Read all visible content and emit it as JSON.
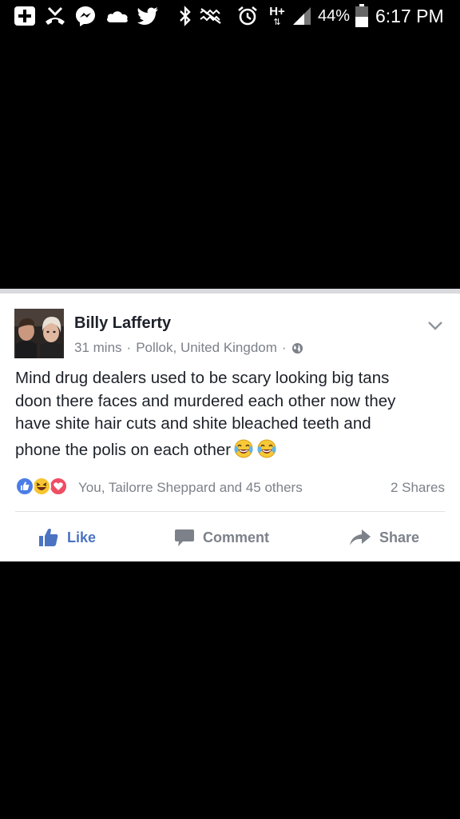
{
  "status_bar": {
    "battery_percent": "44%",
    "time": "6:17 PM",
    "network": "H+",
    "icons_left": [
      "add-square-icon",
      "missed-call-icon",
      "messenger-icon",
      "cloud-icon",
      "twitter-icon"
    ],
    "icons_right": [
      "bluetooth-icon",
      "nfc-icon",
      "alarm-icon",
      "network-icon",
      "signal-icon",
      "battery-icon"
    ]
  },
  "post": {
    "author": "Billy Lafferty",
    "time": "31 mins",
    "separator": "·",
    "location": "Pollok, United Kingdom",
    "privacy": "globe-icon",
    "body_lines": [
      "Mind drug dealers used to be scary looking big tans",
      "doon there faces and murdered each other now they",
      "have shite hair cuts and shite bleached teeth and",
      "phone the polis on each other"
    ],
    "body_emojis": [
      "crying-laughing-emoji",
      "crying-laughing-emoji"
    ],
    "reaction_icons": [
      "like-reaction-icon",
      "haha-reaction-icon",
      "love-reaction-icon"
    ],
    "reaction_summary": "You, Tailorre Sheppard and 45 others",
    "shares": "2 Shares",
    "actions": {
      "like": "Like",
      "comment": "Comment",
      "share": "Share"
    }
  },
  "colors": {
    "like_blue": "#4b73c2",
    "text_primary": "#1d2129",
    "text_secondary": "#7c818a",
    "background": "#000000",
    "card": "#ffffff"
  }
}
